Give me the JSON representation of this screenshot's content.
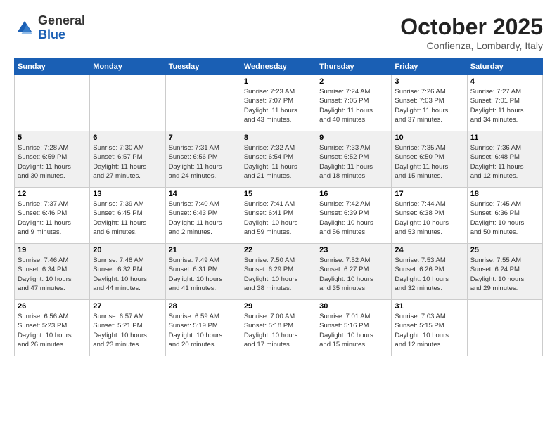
{
  "header": {
    "logo": {
      "general": "General",
      "blue": "Blue"
    },
    "title": "October 2025",
    "location": "Confienza, Lombardy, Italy"
  },
  "weekdays": [
    "Sunday",
    "Monday",
    "Tuesday",
    "Wednesday",
    "Thursday",
    "Friday",
    "Saturday"
  ],
  "weeks": [
    [
      {
        "day": "",
        "info": ""
      },
      {
        "day": "",
        "info": ""
      },
      {
        "day": "",
        "info": ""
      },
      {
        "day": "1",
        "info": "Sunrise: 7:23 AM\nSunset: 7:07 PM\nDaylight: 11 hours\nand 43 minutes."
      },
      {
        "day": "2",
        "info": "Sunrise: 7:24 AM\nSunset: 7:05 PM\nDaylight: 11 hours\nand 40 minutes."
      },
      {
        "day": "3",
        "info": "Sunrise: 7:26 AM\nSunset: 7:03 PM\nDaylight: 11 hours\nand 37 minutes."
      },
      {
        "day": "4",
        "info": "Sunrise: 7:27 AM\nSunset: 7:01 PM\nDaylight: 11 hours\nand 34 minutes."
      }
    ],
    [
      {
        "day": "5",
        "info": "Sunrise: 7:28 AM\nSunset: 6:59 PM\nDaylight: 11 hours\nand 30 minutes."
      },
      {
        "day": "6",
        "info": "Sunrise: 7:30 AM\nSunset: 6:57 PM\nDaylight: 11 hours\nand 27 minutes."
      },
      {
        "day": "7",
        "info": "Sunrise: 7:31 AM\nSunset: 6:56 PM\nDaylight: 11 hours\nand 24 minutes."
      },
      {
        "day": "8",
        "info": "Sunrise: 7:32 AM\nSunset: 6:54 PM\nDaylight: 11 hours\nand 21 minutes."
      },
      {
        "day": "9",
        "info": "Sunrise: 7:33 AM\nSunset: 6:52 PM\nDaylight: 11 hours\nand 18 minutes."
      },
      {
        "day": "10",
        "info": "Sunrise: 7:35 AM\nSunset: 6:50 PM\nDaylight: 11 hours\nand 15 minutes."
      },
      {
        "day": "11",
        "info": "Sunrise: 7:36 AM\nSunset: 6:48 PM\nDaylight: 11 hours\nand 12 minutes."
      }
    ],
    [
      {
        "day": "12",
        "info": "Sunrise: 7:37 AM\nSunset: 6:46 PM\nDaylight: 11 hours\nand 9 minutes."
      },
      {
        "day": "13",
        "info": "Sunrise: 7:39 AM\nSunset: 6:45 PM\nDaylight: 11 hours\nand 6 minutes."
      },
      {
        "day": "14",
        "info": "Sunrise: 7:40 AM\nSunset: 6:43 PM\nDaylight: 11 hours\nand 2 minutes."
      },
      {
        "day": "15",
        "info": "Sunrise: 7:41 AM\nSunset: 6:41 PM\nDaylight: 10 hours\nand 59 minutes."
      },
      {
        "day": "16",
        "info": "Sunrise: 7:42 AM\nSunset: 6:39 PM\nDaylight: 10 hours\nand 56 minutes."
      },
      {
        "day": "17",
        "info": "Sunrise: 7:44 AM\nSunset: 6:38 PM\nDaylight: 10 hours\nand 53 minutes."
      },
      {
        "day": "18",
        "info": "Sunrise: 7:45 AM\nSunset: 6:36 PM\nDaylight: 10 hours\nand 50 minutes."
      }
    ],
    [
      {
        "day": "19",
        "info": "Sunrise: 7:46 AM\nSunset: 6:34 PM\nDaylight: 10 hours\nand 47 minutes."
      },
      {
        "day": "20",
        "info": "Sunrise: 7:48 AM\nSunset: 6:32 PM\nDaylight: 10 hours\nand 44 minutes."
      },
      {
        "day": "21",
        "info": "Sunrise: 7:49 AM\nSunset: 6:31 PM\nDaylight: 10 hours\nand 41 minutes."
      },
      {
        "day": "22",
        "info": "Sunrise: 7:50 AM\nSunset: 6:29 PM\nDaylight: 10 hours\nand 38 minutes."
      },
      {
        "day": "23",
        "info": "Sunrise: 7:52 AM\nSunset: 6:27 PM\nDaylight: 10 hours\nand 35 minutes."
      },
      {
        "day": "24",
        "info": "Sunrise: 7:53 AM\nSunset: 6:26 PM\nDaylight: 10 hours\nand 32 minutes."
      },
      {
        "day": "25",
        "info": "Sunrise: 7:55 AM\nSunset: 6:24 PM\nDaylight: 10 hours\nand 29 minutes."
      }
    ],
    [
      {
        "day": "26",
        "info": "Sunrise: 6:56 AM\nSunset: 5:23 PM\nDaylight: 10 hours\nand 26 minutes."
      },
      {
        "day": "27",
        "info": "Sunrise: 6:57 AM\nSunset: 5:21 PM\nDaylight: 10 hours\nand 23 minutes."
      },
      {
        "day": "28",
        "info": "Sunrise: 6:59 AM\nSunset: 5:19 PM\nDaylight: 10 hours\nand 20 minutes."
      },
      {
        "day": "29",
        "info": "Sunrise: 7:00 AM\nSunset: 5:18 PM\nDaylight: 10 hours\nand 17 minutes."
      },
      {
        "day": "30",
        "info": "Sunrise: 7:01 AM\nSunset: 5:16 PM\nDaylight: 10 hours\nand 15 minutes."
      },
      {
        "day": "31",
        "info": "Sunrise: 7:03 AM\nSunset: 5:15 PM\nDaylight: 10 hours\nand 12 minutes."
      },
      {
        "day": "",
        "info": ""
      }
    ]
  ]
}
